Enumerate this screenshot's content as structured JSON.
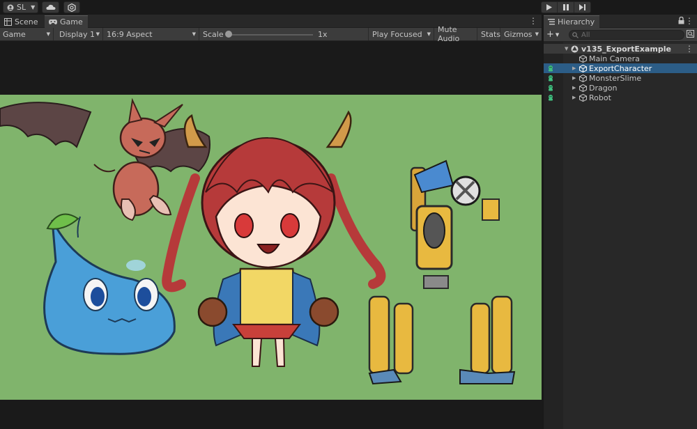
{
  "toolbar": {
    "account_label": "SL",
    "account_icon": "account-icon",
    "cloud_icon": "cloud-icon",
    "collab_icon": "collab-icon",
    "play_icon": "play-icon",
    "pause_icon": "pause-icon",
    "step_icon": "step-icon"
  },
  "game_panel": {
    "tabs": [
      {
        "label": "Scene",
        "icon": "scene-icon"
      },
      {
        "label": "Game",
        "icon": "gamepad-icon"
      }
    ],
    "toolbar": {
      "view_mode": "Game",
      "display": "Display 1",
      "aspect": "16:9 Aspect",
      "scale_label": "Scale",
      "scale_value": "1x",
      "play_mode": "Play Focused",
      "mute_audio": "Mute Audio",
      "stats": "Stats",
      "gizmos": "Gizmos"
    },
    "viewport_bg": "#80b46c"
  },
  "hierarchy": {
    "tab_label": "Hierarchy",
    "search_placeholder": "All",
    "scene_name": "v135_ExportExample",
    "items": [
      {
        "label": "Main Camera",
        "expandable": false,
        "selected": false,
        "vrm": false
      },
      {
        "label": "ExportCharacter",
        "expandable": true,
        "selected": true,
        "vrm": true
      },
      {
        "label": "MonsterSlime",
        "expandable": true,
        "selected": false,
        "vrm": true
      },
      {
        "label": "Dragon",
        "expandable": true,
        "selected": false,
        "vrm": true
      },
      {
        "label": "Robot",
        "expandable": true,
        "selected": false,
        "vrm": true
      }
    ],
    "selection_color": "#2c5d87",
    "vrm_icon_color": "#3fbf7f"
  }
}
